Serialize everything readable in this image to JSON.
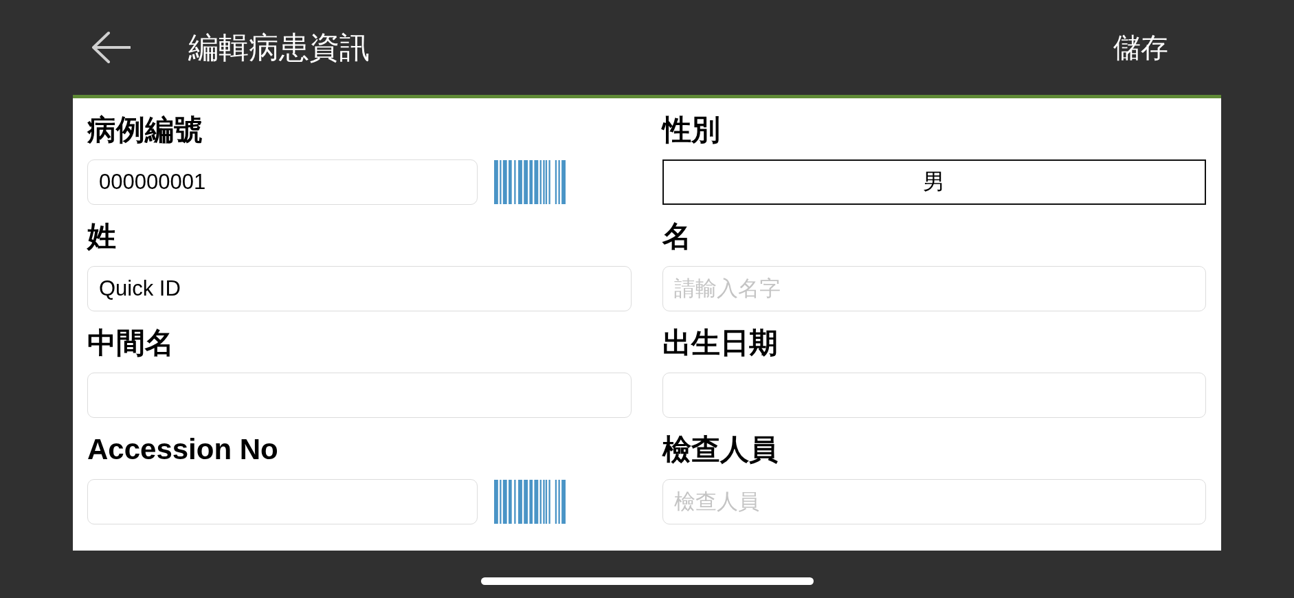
{
  "header": {
    "title": "編輯病患資訊",
    "save_button": "儲存"
  },
  "form": {
    "fields": [
      {
        "label": "病例編號",
        "kind": "text",
        "value": "000000001",
        "barcode": true
      },
      {
        "label": "性別",
        "kind": "choice",
        "value": "男"
      },
      {
        "label": "姓",
        "kind": "text",
        "value": "Quick ID",
        "barcode": false
      },
      {
        "label": "名",
        "kind": "text",
        "placeholder": "請輸入名字",
        "barcode": false
      },
      {
        "label": "中間名",
        "kind": "text",
        "barcode": false
      },
      {
        "label": "出生日期",
        "kind": "text",
        "barcode": false
      },
      {
        "label": "Accession No",
        "kind": "text",
        "barcode": true
      },
      {
        "label": "檢查人員",
        "kind": "text",
        "placeholder": "檢查人員",
        "barcode": false
      }
    ]
  }
}
